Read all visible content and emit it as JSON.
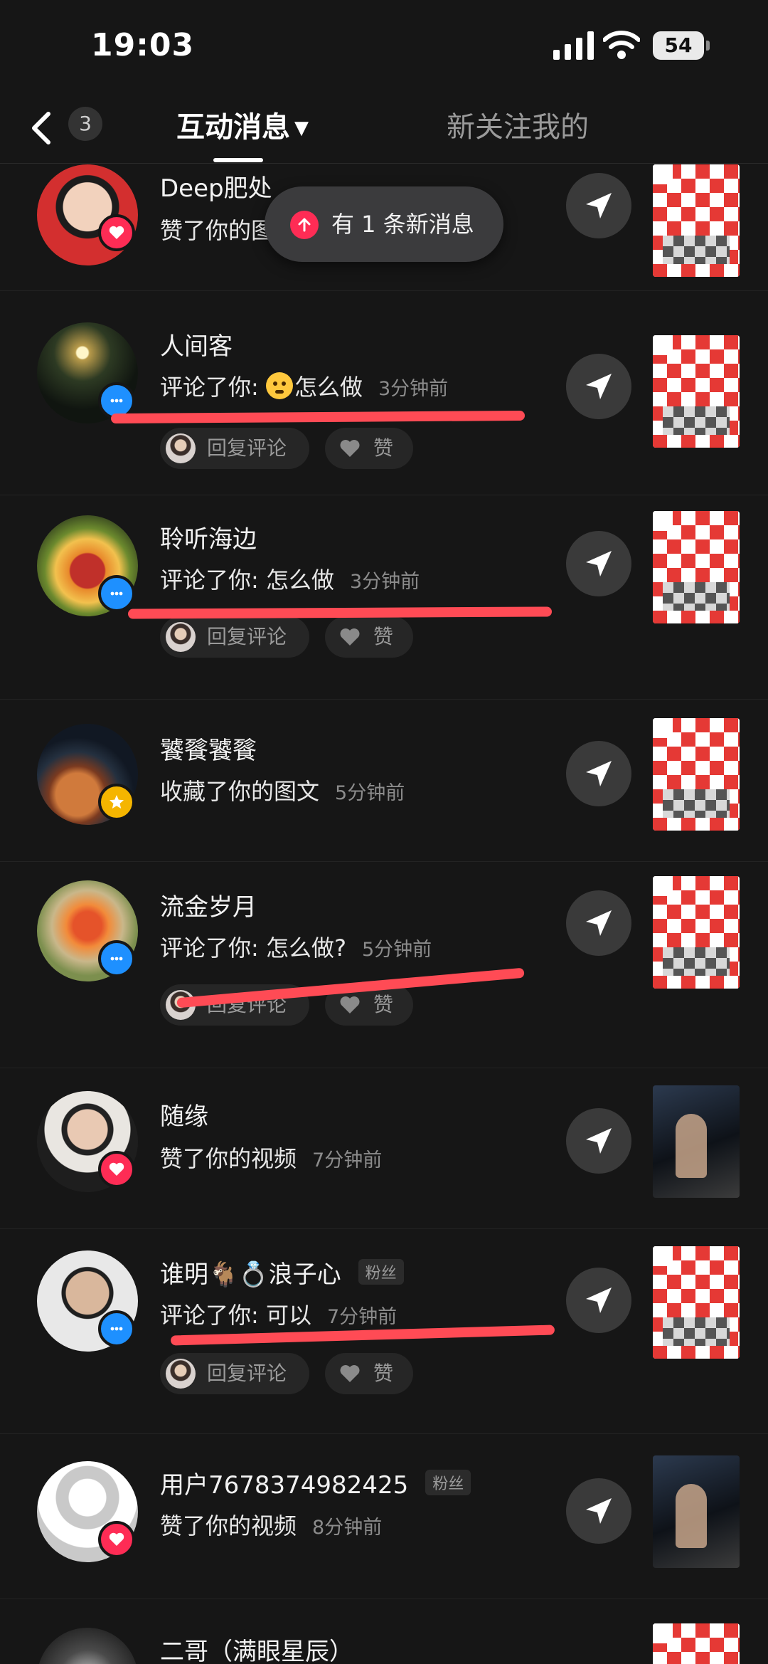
{
  "status_bar": {
    "time": "19:03",
    "battery": "54"
  },
  "header": {
    "back_icon": "chevron-left-icon",
    "unread_badge": "3",
    "tab_active": "互动消息",
    "tab_inactive": "新关注我的"
  },
  "toast": {
    "text": "有 1 条新消息",
    "icon": "arrow-up-icon"
  },
  "pills": {
    "reply": "回复评论",
    "like": "赞"
  },
  "colors": {
    "like": "#fe2c55",
    "comment": "#1e90ff",
    "favorite": "#f5b500",
    "highlight": "#ff4b55"
  },
  "items": [
    {
      "name": "Deep肥处",
      "action": "赞了你的图文",
      "time": "",
      "badge": "heart-icon",
      "thumb": "image"
    },
    {
      "name": "人间客",
      "action": "评论了你: ",
      "action_tail": "怎么做",
      "time": "3分钟前",
      "badge": "comment-icon",
      "thumb": "image",
      "has_emoji": true
    },
    {
      "name": "聆听海边",
      "action": "评论了你: 怎么做",
      "time": "3分钟前",
      "badge": "comment-icon",
      "thumb": "image"
    },
    {
      "name": "饕餮饕餮",
      "action": "收藏了你的图文",
      "time": "5分钟前",
      "badge": "star-icon",
      "thumb": "image"
    },
    {
      "name": "流金岁月",
      "action": "评论了你: 怎么做?",
      "time": "5分钟前",
      "badge": "comment-icon",
      "thumb": "image"
    },
    {
      "name": "随缘",
      "action": "赞了你的视频",
      "time": "7分钟前",
      "badge": "heart-icon",
      "thumb": "video"
    },
    {
      "name": "谁明🐐💍浪子心",
      "tag": "粉丝",
      "action": "评论了你: 可以",
      "time": "7分钟前",
      "badge": "comment-icon",
      "thumb": "image"
    },
    {
      "name": "用户7678374982425",
      "tag": "粉丝",
      "action": "赞了你的视频",
      "time": "8分钟前",
      "badge": "heart-icon",
      "thumb": "video"
    },
    {
      "name": "二哥（满眼星辰）",
      "action": "",
      "time": "",
      "badge": "",
      "thumb": "image"
    }
  ]
}
